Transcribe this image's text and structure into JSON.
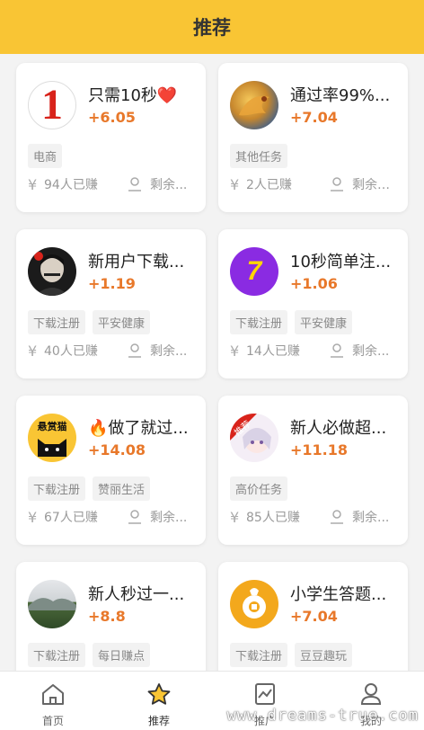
{
  "header": {
    "title": "推荐"
  },
  "cards": [
    {
      "avatar": "red-number-1",
      "title": "只需10秒❤️",
      "reward": "+6.05",
      "tags": [
        "电商"
      ],
      "earned": "94人已赚",
      "remain": "剩余..."
    },
    {
      "avatar": "dragon-image",
      "title": "通过率99%...",
      "reward": "+7.04",
      "tags": [
        "其他任务"
      ],
      "earned": "2人已赚",
      "remain": "剩余2..."
    },
    {
      "avatar": "portrait-man",
      "title": "新用户下载...",
      "reward": "+1.19",
      "tags": [
        "下载注册",
        "平安健康"
      ],
      "earned": "40人已赚",
      "remain": "剩余..."
    },
    {
      "avatar": "purple-number-7",
      "title": "10秒简单注...",
      "reward": "+1.06",
      "tags": [
        "下载注册",
        "平安健康"
      ],
      "earned": "14人已赚",
      "remain": "剩余..."
    },
    {
      "avatar": "cat-logo",
      "avatar_text": "悬赏猫",
      "title": "🔥做了就过...",
      "reward": "+14.08",
      "tags": [
        "下载注册",
        "赞丽生活"
      ],
      "earned": "67人已赚",
      "remain": "剩余..."
    },
    {
      "avatar": "anime-girl",
      "avatar_text": "推荐",
      "title": "新人必做超...",
      "reward": "+11.18",
      "tags": [
        "高价任务"
      ],
      "earned": "85人已赚",
      "remain": "剩余..."
    },
    {
      "avatar": "mountain-photo",
      "title": "新人秒过一...",
      "reward": "+8.8",
      "tags": [
        "下载注册",
        "每日赚点"
      ],
      "earned": "",
      "remain": ""
    },
    {
      "avatar": "orange-coin",
      "title": "小学生答题...",
      "reward": "+7.04",
      "tags": [
        "下载注册",
        "豆豆趣玩"
      ],
      "earned": "",
      "remain": ""
    }
  ],
  "tabbar": [
    {
      "label": "首页",
      "icon": "home-icon",
      "active": false
    },
    {
      "label": "推荐",
      "icon": "star-icon",
      "active": true
    },
    {
      "label": "推广",
      "icon": "chart-icon",
      "active": false
    },
    {
      "label": "我的",
      "icon": "user-icon",
      "active": false
    }
  ],
  "watermark": "www.dreams-true.com",
  "colors": {
    "accent": "#f9c534",
    "reward": "#e8782a"
  }
}
